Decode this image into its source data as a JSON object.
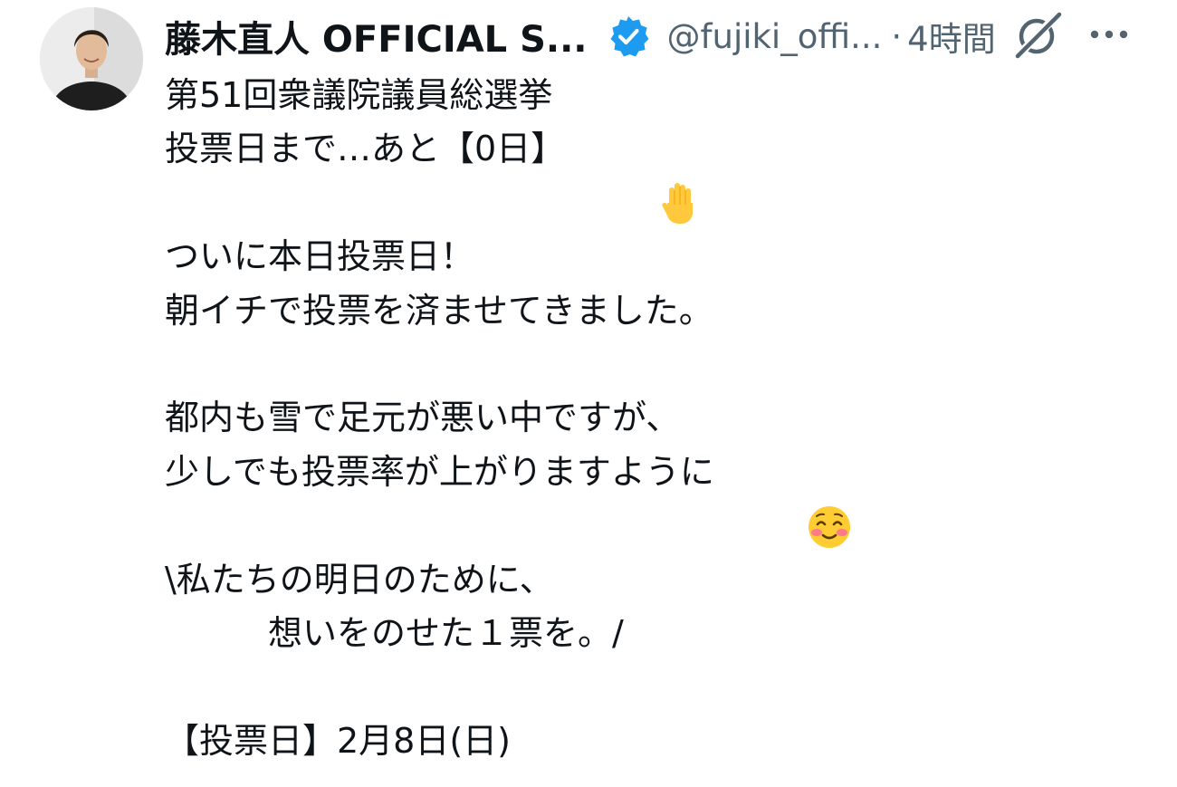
{
  "author": {
    "display_name": "藤木直人 OFFICIAL S...",
    "handle": "@fujiki_offi...",
    "separator": "·",
    "time": "4時間",
    "verified_color": "#1d9bf0"
  },
  "icons": {
    "verified": "verified-badge-icon",
    "grok": "grok-icon",
    "more": "more-horizontal-icon",
    "raised_hand": "raised-hand-emoji",
    "smiling_face": "smiling-face-emoji"
  },
  "tweet": {
    "lines": [
      "第51回衆議院議員総選挙",
      "投票日まで…あと【0日】",
      "",
      "ついに本日投票日！",
      "朝イチで投票を済ませてきました。",
      "",
      "都内も雪で足元が悪い中ですが、",
      "少しでも投票率が上がりますように",
      "",
      "\\私たちの明日のために、",
      "　　　想いをのせた１票を。/",
      "",
      "【投票日】2月8日(日)"
    ]
  }
}
